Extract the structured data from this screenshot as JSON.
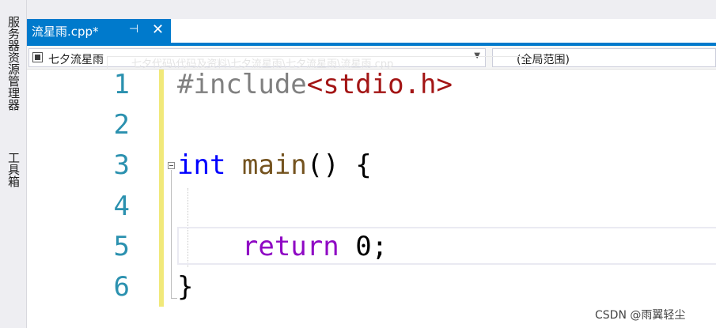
{
  "sidebar": {
    "tabs": [
      "服务器资源管理器",
      "工具箱"
    ]
  },
  "document_tab": {
    "title": "流星雨.cpp*",
    "pin_glyph": "⊣",
    "close_glyph": "✕"
  },
  "navigation": {
    "scope_combo": "七夕流星雨",
    "member_combo": "(全局范围)",
    "ghost_path": "七夕代码\\代码及资料\\七夕流星雨\\七夕流星雨\\流星雨.cpp"
  },
  "editor": {
    "line_numbers": [
      "1",
      "2",
      "3",
      "4",
      "5",
      "6"
    ],
    "lines": {
      "l1_directive": "#include",
      "l1_header": "<stdio.h>",
      "l3_type": "int",
      "l3_func": "main",
      "l3_rest": "() {",
      "l5_indent": "    ",
      "l5_keyword": "return",
      "l5_rest": " 0;",
      "l6_brace": "}"
    }
  },
  "watermark": "CSDN @雨翼轻尘",
  "colors": {
    "accent_tab": "#007acc",
    "line_number": "#2b91af",
    "keyword": "#0000ff",
    "control_keyword": "#8f08c4",
    "include_path": "#a31515",
    "preprocessor": "#808080",
    "change_bar": "#f1e97a"
  }
}
